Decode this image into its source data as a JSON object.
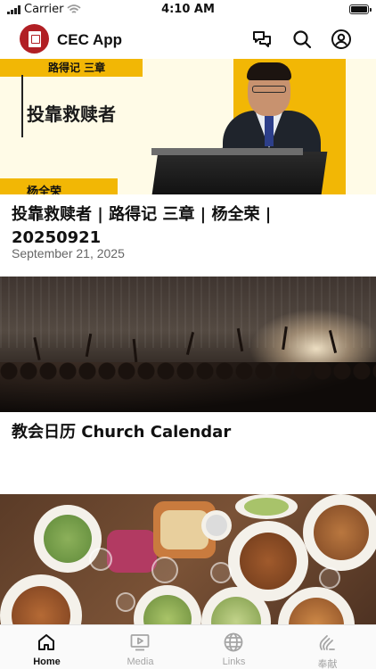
{
  "status_bar": {
    "carrier": "Carrier",
    "time": "4:10 AM"
  },
  "header": {
    "title": "CEC App",
    "icons": [
      "chat-icon",
      "search-icon",
      "account-icon"
    ]
  },
  "posts": [
    {
      "image_text": {
        "book": "路得记 三章",
        "sermon": "投靠救赎者",
        "speaker": "杨全荣"
      },
      "title": "投靠救赎者 | 路得记 三章 | 杨全荣 | 20250921",
      "date": "September 21, 2025"
    },
    {
      "title": "教会日历 Church Calendar"
    },
    {
      "title": ""
    }
  ],
  "tabs": [
    {
      "label": "Home",
      "icon": "home-icon",
      "active": true
    },
    {
      "label": "Media",
      "icon": "media-icon",
      "active": false
    },
    {
      "label": "Links",
      "icon": "globe-icon",
      "active": false
    },
    {
      "label": "奉献",
      "icon": "giving-icon",
      "active": false
    }
  ],
  "colors": {
    "brand_red": "#b11f24",
    "accent_yellow": "#f2b705",
    "tab_active": "#111111",
    "tab_inactive": "#a5a5a5"
  }
}
